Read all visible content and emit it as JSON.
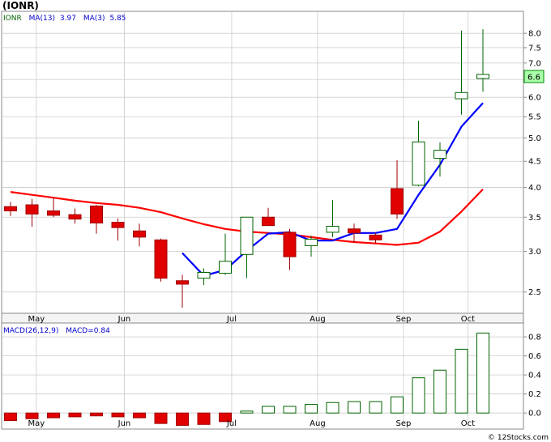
{
  "page": {
    "title": "(IONR)",
    "footer": "© 12Stocks.com"
  },
  "colors": {
    "up_fill": "#ffffff",
    "up_stroke": "#006400",
    "down_fill": "#e00000",
    "down_stroke": "#a00000",
    "ma13": "#ff0000",
    "ma3": "#0000ff",
    "grid": "#cccccc",
    "last_price_bg": "#aaffaa",
    "legend_ticker": "#006400",
    "legend_ma": "#0000cc"
  },
  "legend": {
    "ticker": "IONR",
    "ma13_label": "MA(13)",
    "ma13_value": "3.97",
    "ma3_label": "MA(3)",
    "ma3_value": "5.85",
    "macd_params": "MACD(26,12,9)",
    "macd_label": "MACD=0.84"
  },
  "chart_data": [
    {
      "type": "candlestick",
      "scale": "log",
      "ylim": [
        2.28,
        8.8
      ],
      "price_ticks": [
        "2.5",
        "3.0",
        "3.5",
        "4.0",
        "4.5",
        "5.0",
        "5.5",
        "6.0",
        "6.5",
        "7.0",
        "7.5",
        "8.0"
      ],
      "month_labels": [
        "May",
        "Jun",
        "Jul",
        "Aug",
        "Sep",
        "Oct"
      ],
      "last_price": "6.6",
      "candles": [
        {
          "o": 3.67,
          "h": 3.75,
          "l": 3.52,
          "c": 3.6
        },
        {
          "o": 3.7,
          "h": 3.8,
          "l": 3.35,
          "c": 3.55
        },
        {
          "o": 3.6,
          "h": 3.82,
          "l": 3.5,
          "c": 3.53
        },
        {
          "o": 3.54,
          "h": 3.64,
          "l": 3.4,
          "c": 3.47
        },
        {
          "o": 3.68,
          "h": 3.7,
          "l": 3.25,
          "c": 3.41
        },
        {
          "o": 3.42,
          "h": 3.48,
          "l": 3.15,
          "c": 3.34
        },
        {
          "o": 3.29,
          "h": 3.4,
          "l": 3.07,
          "c": 3.2
        },
        {
          "o": 3.16,
          "h": 3.18,
          "l": 2.62,
          "c": 2.66
        },
        {
          "o": 2.63,
          "h": 2.7,
          "l": 2.33,
          "c": 2.59
        },
        {
          "o": 2.66,
          "h": 2.78,
          "l": 2.58,
          "c": 2.73
        },
        {
          "o": 2.72,
          "h": 3.25,
          "l": 2.7,
          "c": 2.87
        },
        {
          "o": 2.96,
          "h": 3.5,
          "l": 2.66,
          "c": 3.5
        },
        {
          "o": 3.5,
          "h": 3.65,
          "l": 3.37,
          "c": 3.37
        },
        {
          "o": 3.27,
          "h": 3.32,
          "l": 2.76,
          "c": 2.93
        },
        {
          "o": 3.08,
          "h": 3.22,
          "l": 2.93,
          "c": 3.17
        },
        {
          "o": 3.27,
          "h": 3.78,
          "l": 3.2,
          "c": 3.36
        },
        {
          "o": 3.32,
          "h": 3.4,
          "l": 3.12,
          "c": 3.26
        },
        {
          "o": 3.23,
          "h": 3.26,
          "l": 3.12,
          "c": 3.16
        },
        {
          "o": 3.98,
          "h": 4.52,
          "l": 3.47,
          "c": 3.55
        },
        {
          "o": 4.04,
          "h": 5.4,
          "l": 4.02,
          "c": 4.91
        },
        {
          "o": 4.56,
          "h": 4.9,
          "l": 4.2,
          "c": 4.73
        },
        {
          "o": 5.96,
          "h": 8.1,
          "l": 5.55,
          "c": 6.13
        },
        {
          "o": 6.53,
          "h": 8.15,
          "l": 6.15,
          "c": 6.65
        }
      ],
      "ma13": [
        3.92,
        3.87,
        3.82,
        3.77,
        3.73,
        3.7,
        3.65,
        3.58,
        3.48,
        3.39,
        3.32,
        3.28,
        3.26,
        3.24,
        3.2,
        3.16,
        3.13,
        3.11,
        3.09,
        3.12,
        3.28,
        3.59,
        3.97
      ],
      "ma3": [
        null,
        null,
        null,
        null,
        null,
        null,
        null,
        null,
        2.98,
        2.69,
        2.76,
        3.01,
        3.25,
        3.27,
        3.15,
        3.15,
        3.26,
        3.26,
        3.32,
        3.87,
        4.43,
        5.26,
        5.85
      ],
      "sample_ma13_first": 3.92,
      "sample_ma13_second": 3.87
    },
    {
      "type": "bar",
      "title": "MACD",
      "ylim": [
        -0.16,
        0.92
      ],
      "yticks": [
        "0.0",
        "0.2",
        "0.4",
        "0.6",
        "0.8"
      ],
      "values": [
        -0.08,
        -0.06,
        -0.05,
        -0.04,
        -0.03,
        -0.04,
        -0.05,
        -0.11,
        -0.13,
        -0.12,
        -0.09,
        0.02,
        0.07,
        0.07,
        0.09,
        0.11,
        0.12,
        0.12,
        0.17,
        0.37,
        0.45,
        0.67,
        0.84
      ]
    }
  ]
}
